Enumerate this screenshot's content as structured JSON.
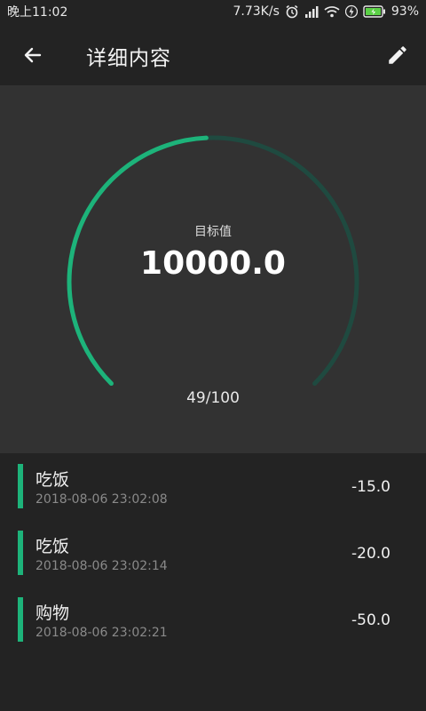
{
  "status_bar": {
    "time": "晚上11:02",
    "network_speed": "7.73K/s",
    "battery": "93%",
    "icons": [
      "alarm-icon",
      "signal-icon",
      "wifi-icon",
      "charging-icon",
      "battery-icon"
    ]
  },
  "app_bar": {
    "title": "详细内容",
    "back_icon": "arrow-left-icon",
    "edit_icon": "pencil-icon"
  },
  "gauge": {
    "label": "目标值",
    "value": "10000.0",
    "progress_text": "49/100",
    "progress_fraction": 0.49,
    "accent_color": "#1db37a",
    "track_color": "#1f4a40"
  },
  "records": [
    {
      "name": "吃饭",
      "time": "2018-08-06 23:02:08",
      "amount": "-15.0"
    },
    {
      "name": "吃饭",
      "time": "2018-08-06 23:02:14",
      "amount": "-20.0"
    },
    {
      "name": "购物",
      "time": "2018-08-06 23:02:21",
      "amount": "-50.0"
    }
  ]
}
